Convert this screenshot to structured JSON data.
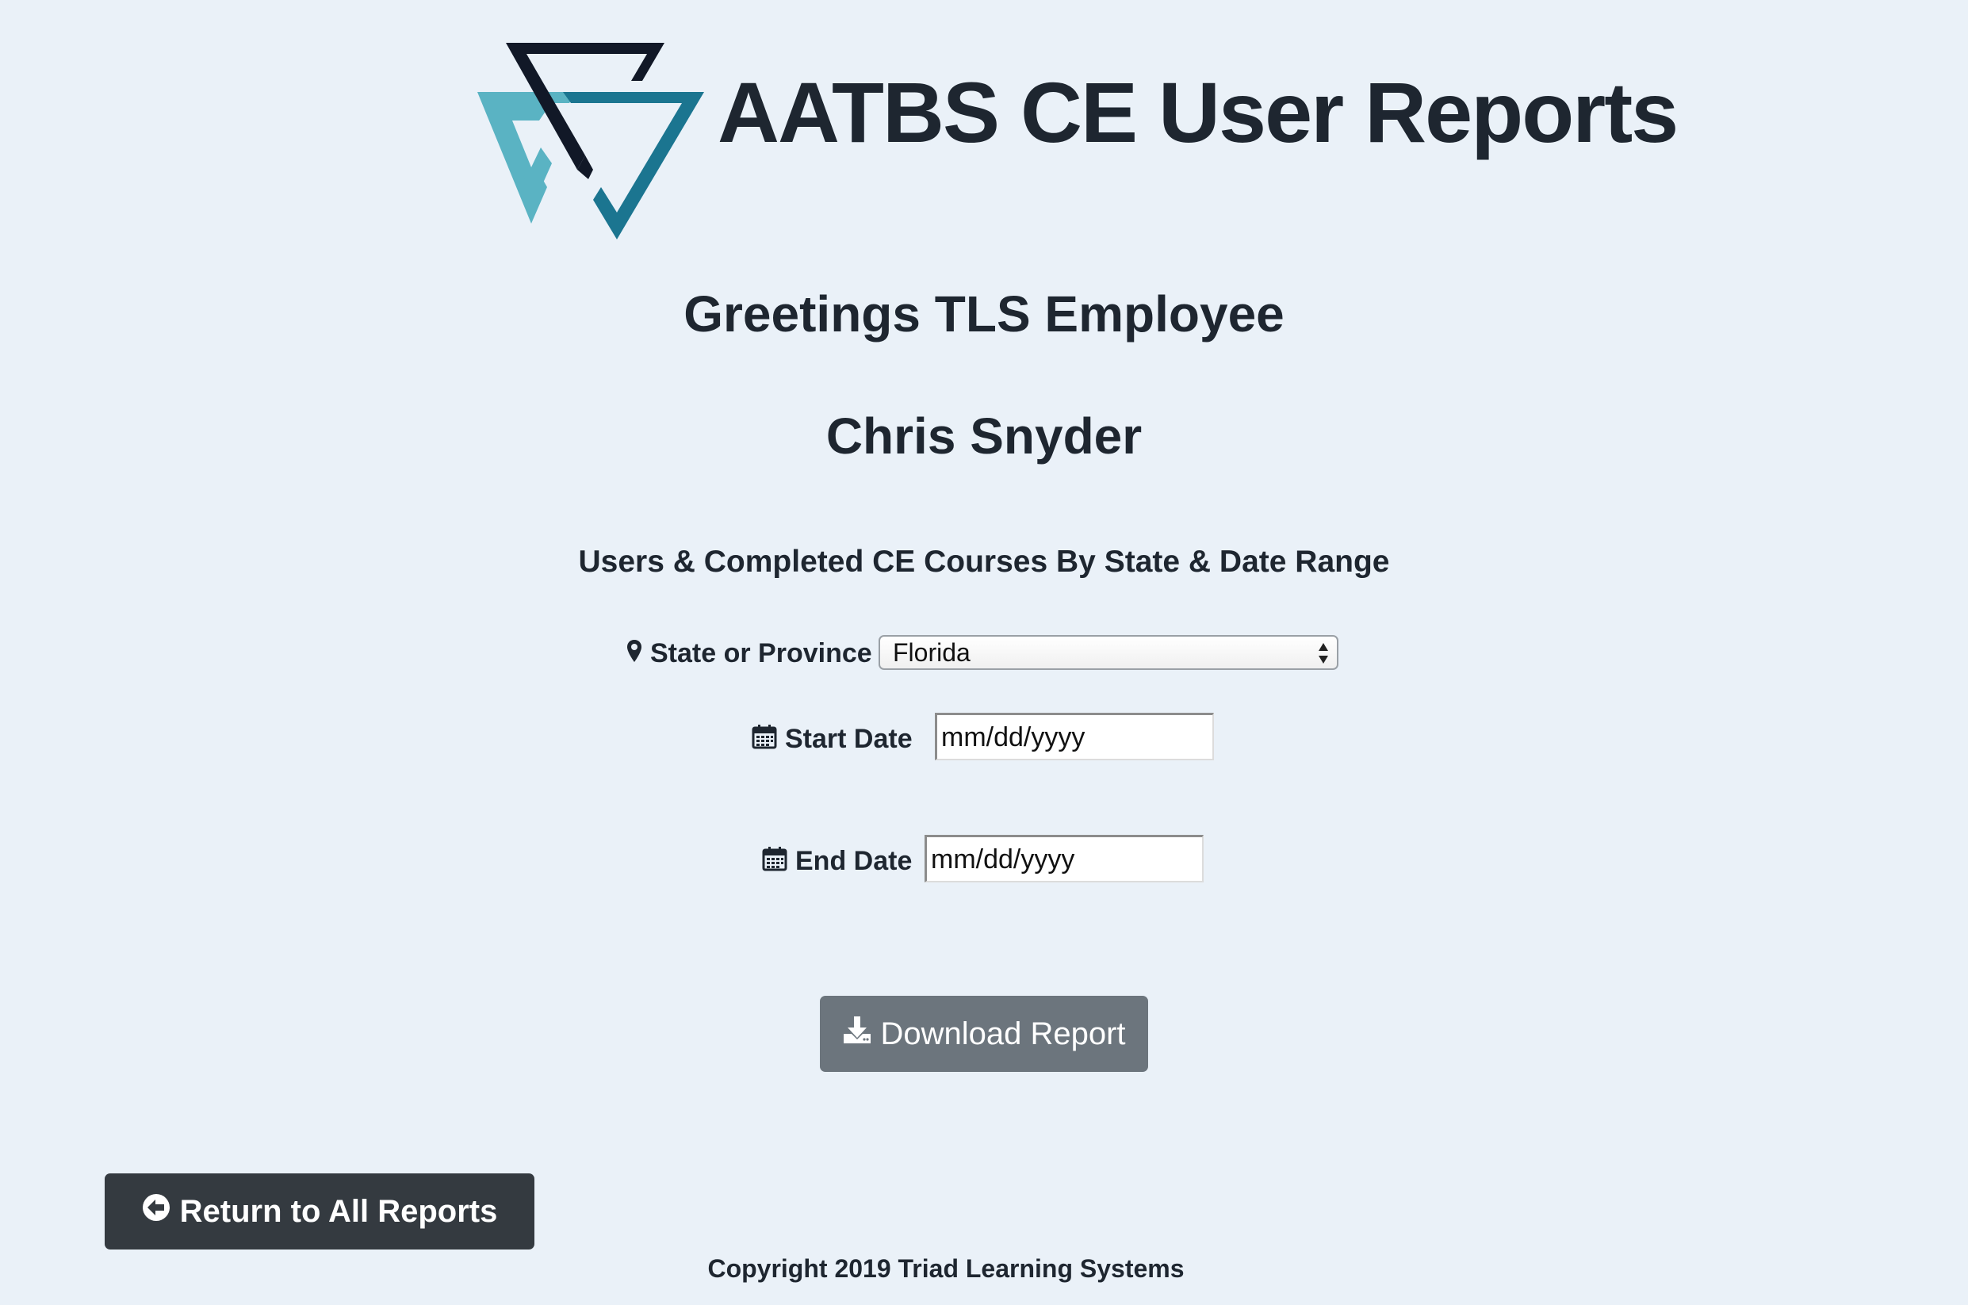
{
  "header": {
    "app_title": "AATBS CE User Reports",
    "logo_icon": "aatbs-triangle-logo",
    "colors": {
      "navy": "#111827",
      "teal_light": "#5ab3c3",
      "teal_dark": "#1b7590"
    }
  },
  "greeting": "Greetings TLS Employee",
  "user": {
    "name": "Chris Snyder"
  },
  "report": {
    "title": "Users & Completed CE Courses By State & Date Range"
  },
  "form": {
    "state": {
      "label": "State or Province",
      "icon": "map-marker-icon",
      "selected": "Florida"
    },
    "start_date": {
      "label": "Start Date",
      "icon": "calendar-icon",
      "placeholder": "mm/dd/yyyy"
    },
    "end_date": {
      "label": "End Date",
      "icon": "calendar-icon",
      "placeholder": "mm/dd/yyyy"
    }
  },
  "actions": {
    "download_label": "Download Report",
    "download_icon": "download-icon",
    "return_label": "Return to All Reports",
    "return_icon": "arrow-circle-left-icon"
  },
  "footer": {
    "copyright": "Copyright 2019 Triad Learning Systems"
  }
}
